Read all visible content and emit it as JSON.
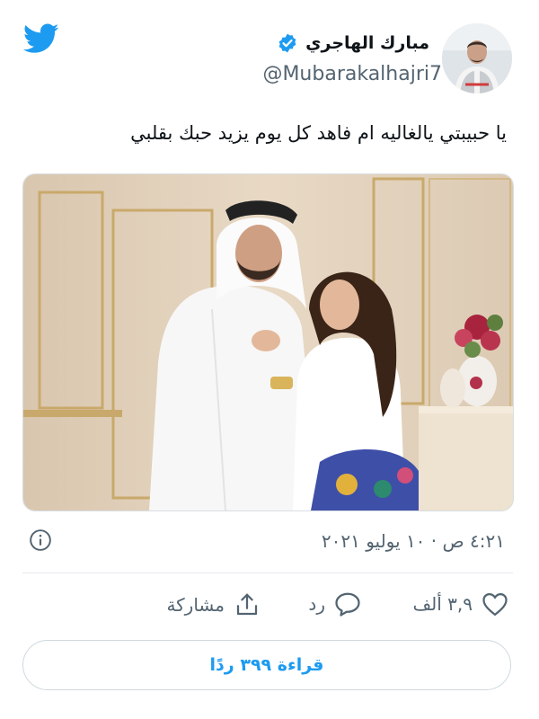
{
  "author": {
    "display_name": "مبارك الهاجري",
    "handle": "@Mubarakalhajri7",
    "verified": true,
    "avatar_icon": "avatar-photo"
  },
  "tweet": {
    "text": "يا حبيبتي يالغاليه ام فاهد كل يوم يزيد حبك بقلبي",
    "image_icon": "photo-couple"
  },
  "meta": {
    "timestamp": "٤:٢١ ص · ١٠ يوليو ٢٠٢١"
  },
  "actions": {
    "like_count": "٣,٩ ألف",
    "reply_label": "رد",
    "share_label": "مشاركة"
  },
  "read_replies_label": "قراءة ٣٩٩ ردًا",
  "colors": {
    "brand": "#1d9bf0",
    "text": "#0f1419",
    "muted": "#536471",
    "border": "#cfd9de"
  }
}
